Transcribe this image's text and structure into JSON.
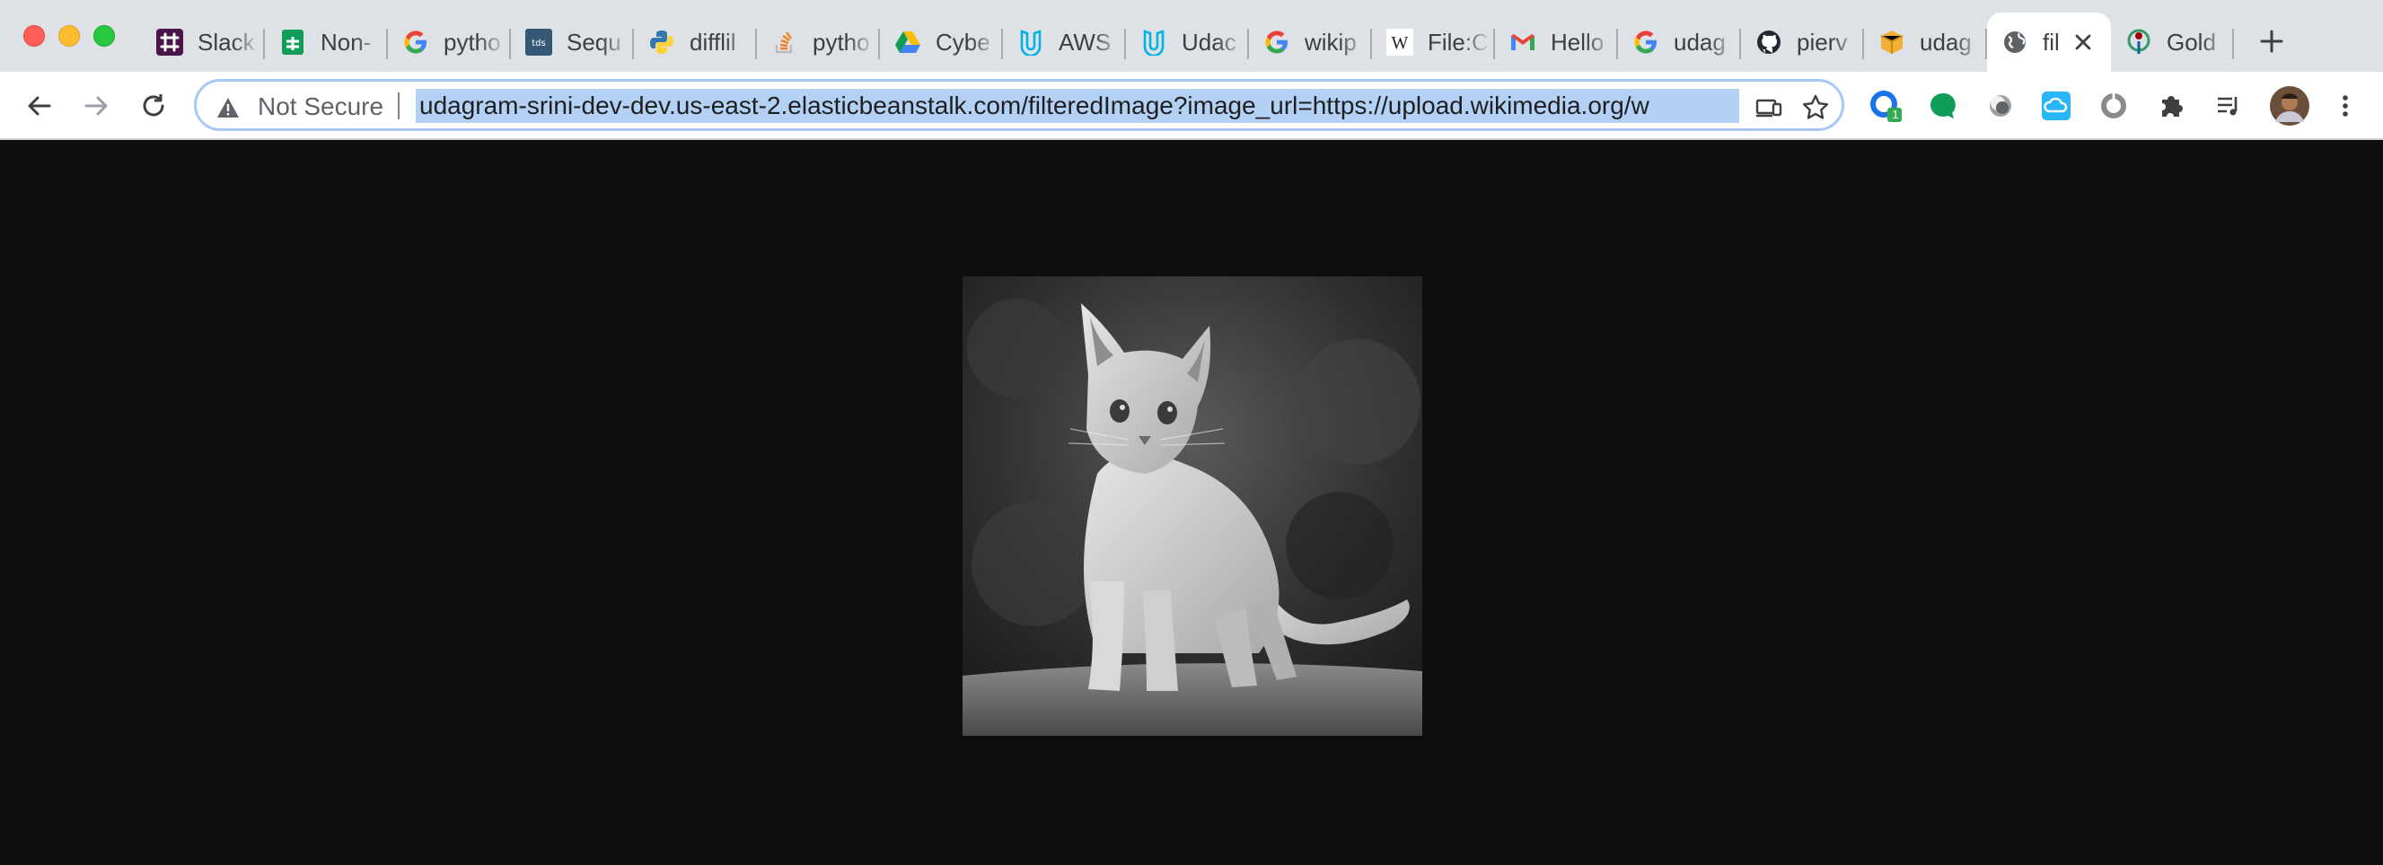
{
  "window": {
    "tabs": [
      {
        "title": "Slack",
        "icon": "slack-icon"
      },
      {
        "title": "Non-",
        "icon": "google-sheets-icon"
      },
      {
        "title": "pytho",
        "icon": "google-icon"
      },
      {
        "title": "Sequ",
        "icon": "tds-icon"
      },
      {
        "title": "difflil",
        "icon": "python-icon"
      },
      {
        "title": "pytho",
        "icon": "stackoverflow-icon"
      },
      {
        "title": "Cybe",
        "icon": "google-drive-icon"
      },
      {
        "title": "AWS",
        "icon": "udacity-icon"
      },
      {
        "title": "Udac",
        "icon": "udacity-icon"
      },
      {
        "title": "wikip",
        "icon": "google-icon"
      },
      {
        "title": "File:C",
        "icon": "wikipedia-icon"
      },
      {
        "title": "Hello",
        "icon": "gmail-icon"
      },
      {
        "title": "udag",
        "icon": "google-icon"
      },
      {
        "title": "pierv",
        "icon": "github-icon"
      },
      {
        "title": "udag",
        "icon": "package-icon"
      },
      {
        "title": "fil",
        "icon": "globe-icon",
        "active": true
      },
      {
        "title": "Gold",
        "icon": "wikimedia-icon"
      }
    ]
  },
  "toolbar": {
    "security_label": "Not Secure",
    "url": "udagram-srini-dev-dev.us-east-2.elasticbeanstalk.com/filteredImage?image_url=https://upload.wikimedia.org/w",
    "extension_badge": "1"
  },
  "content": {
    "image_alt": "kitten"
  },
  "colors": {
    "tabstrip_bg": "#dee1e6",
    "page_bg": "#0e0e0e",
    "url_selection": "#b3d1f5",
    "omnibox_focus": "#a8c7fa"
  }
}
